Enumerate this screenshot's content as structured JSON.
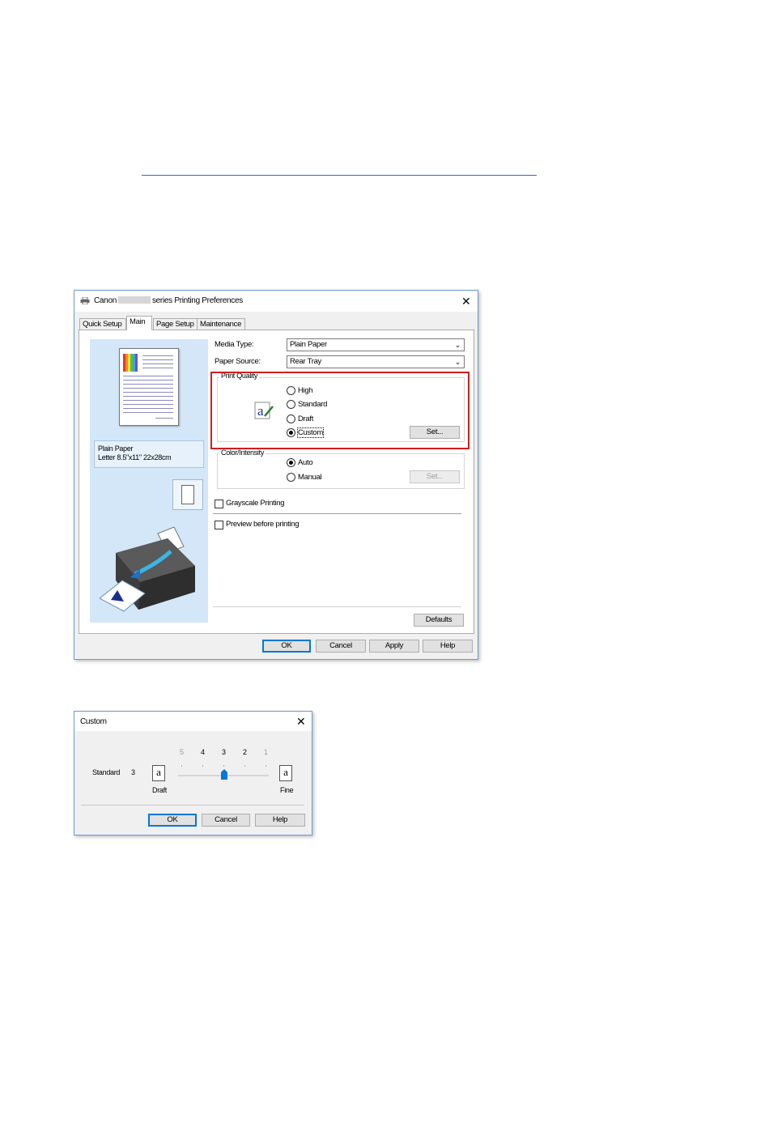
{
  "main_dialog": {
    "title_prefix": "Canon",
    "title_suffix": "series Printing Preferences",
    "tabs": [
      "Quick Setup",
      "Main",
      "Page Setup",
      "Maintenance"
    ],
    "media_type_label": "Media Type:",
    "media_type_value": "Plain Paper",
    "paper_source_label": "Paper Source:",
    "paper_source_value": "Rear Tray",
    "print_quality": {
      "title": "Print Quality",
      "options": [
        "High",
        "Standard",
        "Draft",
        "Custom"
      ],
      "selected": "Custom",
      "set_label": "Set..."
    },
    "color_intensity": {
      "title": "Color/Intensity",
      "options": [
        "Auto",
        "Manual"
      ],
      "selected": "Auto",
      "set_label": "Set..."
    },
    "preview_media": "Plain Paper",
    "preview_size": "Letter 8.5\"x11\" 22x28cm",
    "grayscale_label": "Grayscale Printing",
    "preview_before_label": "Preview before printing",
    "defaults_label": "Defaults",
    "buttons": {
      "ok": "OK",
      "cancel": "Cancel",
      "apply": "Apply",
      "help": "Help"
    },
    "highlight_color": "#d11e1e"
  },
  "custom_dialog": {
    "title": "Custom",
    "standard_label": "Standard",
    "standard_value": "3",
    "scale": [
      "5",
      "4",
      "3",
      "2",
      "1"
    ],
    "slider_value": 3,
    "draft_label": "Draft",
    "fine_label": "Fine",
    "icon_glyph": "a",
    "buttons": {
      "ok": "OK",
      "cancel": "Cancel",
      "help": "Help"
    }
  }
}
